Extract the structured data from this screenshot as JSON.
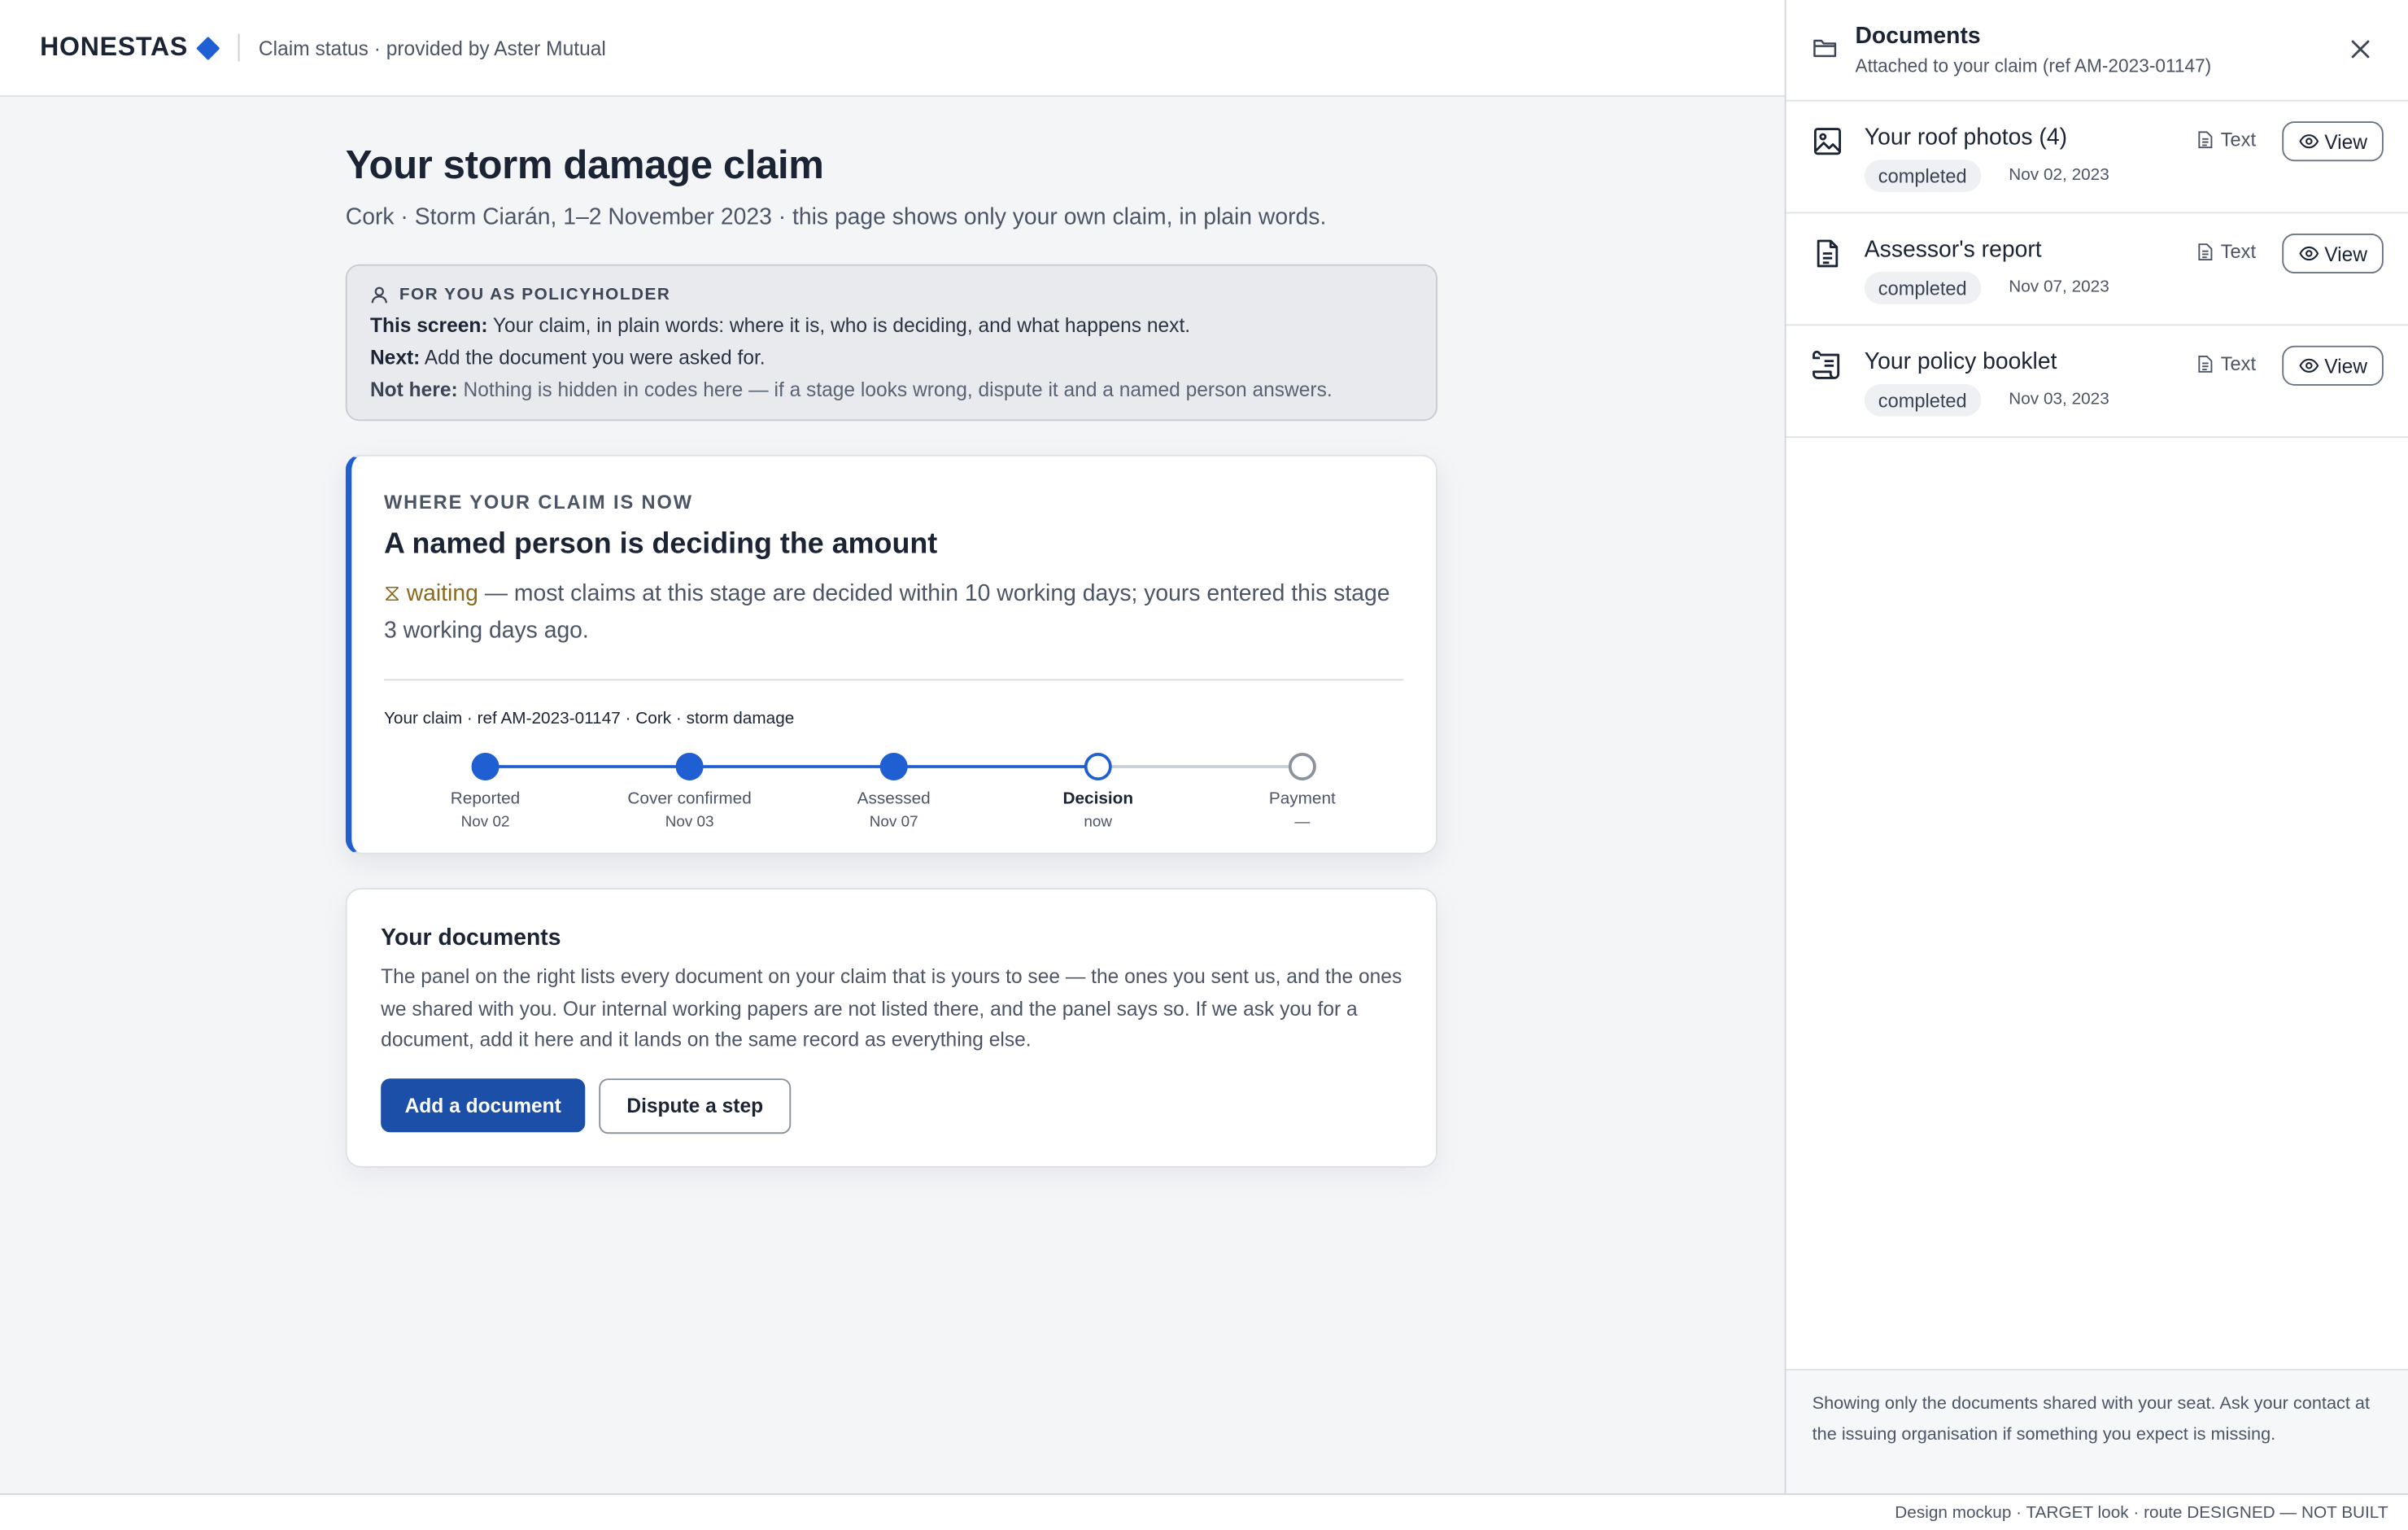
{
  "header": {
    "brand": "HONESTAS",
    "subtitle": "Claim status · provided by Aster Mutual"
  },
  "main": {
    "title": "Your storm damage claim",
    "subtitle": "Cork · Storm Ciarán, 1–2 November 2023 · this page shows only your own claim, in plain words."
  },
  "callout": {
    "heading": "FOR YOU AS POLICYHOLDER",
    "lines": [
      {
        "label": "This screen:",
        "text": " Your claim, in plain words: where it is, who is deciding, and what happens next."
      },
      {
        "label": "Next:",
        "text": " Add the document you were asked for."
      },
      {
        "label": "Not here:",
        "text": " Nothing is hidden in codes here — if a stage looks wrong, dispute it and a named person answers."
      }
    ]
  },
  "status": {
    "eyebrow": "WHERE YOUR CLAIM IS NOW",
    "title": "A named person is deciding the amount",
    "waiting_label": "⧖ waiting",
    "detail": " — most claims at this stage are decided within 10 working days; yours entered this stage 3 working days ago.",
    "claim_ref": "Your claim · ref AM-2023-01147 · Cork · storm damage",
    "steps": [
      {
        "label": "Reported",
        "date": "Nov 02",
        "state": "done"
      },
      {
        "label": "Cover confirmed",
        "date": "Nov 03",
        "state": "done"
      },
      {
        "label": "Assessed",
        "date": "Nov 07",
        "state": "done"
      },
      {
        "label": "Decision",
        "date": "now",
        "state": "current"
      },
      {
        "label": "Payment",
        "date": "—",
        "state": "todo"
      }
    ],
    "colors": {
      "accent": "#1f5fd1",
      "pending": "#8a929e"
    }
  },
  "documents_card": {
    "title": "Your documents",
    "text": "The panel on the right lists every document on your claim that is yours to see — the ones you sent us, and the ones we shared with you. Our internal working papers are not listed there, and the panel says so. If we ask you for a document, add it here and it lands on the same record as everything else.",
    "primary_button": "Add a document",
    "secondary_button": "Dispute a step"
  },
  "panel": {
    "title": "Documents",
    "subtitle": "Attached to your claim (ref AM-2023-01147)",
    "close_icon": "close-icon",
    "text_label": "Text",
    "view_label": "View",
    "items": [
      {
        "name": "Your roof photos (4)",
        "status": "completed",
        "date": "Nov 02, 2023",
        "icon": "image-icon"
      },
      {
        "name": "Assessor's report",
        "status": "completed",
        "date": "Nov 07, 2023",
        "icon": "document-icon"
      },
      {
        "name": "Your policy booklet",
        "status": "completed",
        "date": "Nov 03, 2023",
        "icon": "scroll-icon"
      }
    ],
    "footer": "Showing only the documents shared with your seat. Ask your contact at the issuing organisation if something you expect is missing."
  },
  "footer_note": "Design mockup · TARGET look · route DESIGNED — NOT BUILT"
}
